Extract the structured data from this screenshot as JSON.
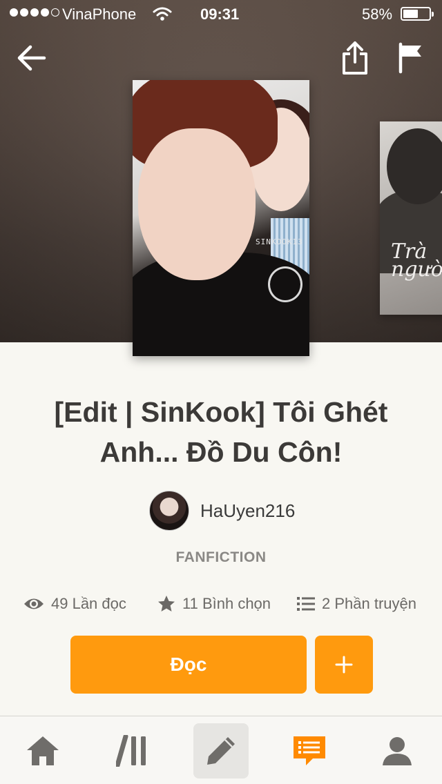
{
  "status_bar": {
    "carrier": "VinaPhone",
    "time": "09:31",
    "battery": "58%",
    "battery_level": 0.58,
    "signal_bars": 4,
    "signal_total": 5
  },
  "header": {
    "back_icon": "arrow-left-icon",
    "share_icon": "share-icon",
    "flag_icon": "flag-icon"
  },
  "covers": {
    "main_watermark": "SINKOOK13",
    "side_script": "Trà người"
  },
  "story": {
    "title": "[Edit | SinKook] Tôi Ghét Anh... Đồ Du Côn!",
    "author": "HaUyen216",
    "category": "FANFICTION"
  },
  "stats": {
    "reads": "49 Lần đọc",
    "votes": "11 Bình chọn",
    "parts": "2 Phần truyện"
  },
  "actions": {
    "read_label": "Đọc",
    "add_icon": "plus-icon"
  },
  "tab_bar": {
    "items": [
      {
        "icon": "home-icon"
      },
      {
        "icon": "library-icon"
      },
      {
        "icon": "pencil-icon",
        "selected": true
      },
      {
        "icon": "messages-icon"
      },
      {
        "icon": "profile-icon"
      }
    ]
  },
  "colors": {
    "accent": "#ff9a0e",
    "tab_inactive": "#6f6d6a",
    "text_primary": "#3c3a38",
    "text_secondary": "#6b6966"
  }
}
